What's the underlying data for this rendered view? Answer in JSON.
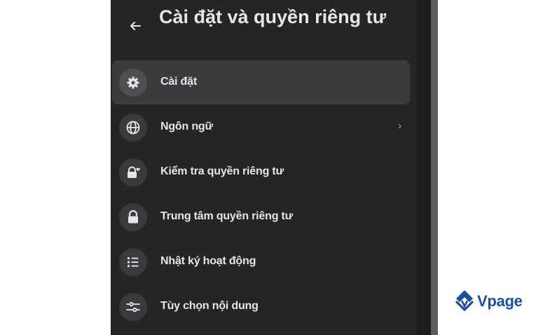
{
  "header": {
    "back_icon": "arrow-left-icon",
    "title": "Cài đặt và quyền riêng tư"
  },
  "menu": {
    "items": [
      {
        "label": "Cài đặt",
        "icon": "gear-icon",
        "active": true
      },
      {
        "label": "Ngôn ngữ",
        "icon": "globe-icon",
        "has_chevron": true,
        "chevron": "›"
      },
      {
        "label": "Kiểm tra quyền riêng tư",
        "icon": "lock-heart-icon"
      },
      {
        "label": "Trung tâm quyền riêng tư",
        "icon": "lock-icon"
      },
      {
        "label": "Nhật ký hoạt động",
        "icon": "list-icon"
      },
      {
        "label": "Tùy chọn nội dung",
        "icon": "sliders-icon"
      }
    ]
  },
  "watermark": {
    "brand": "Vpage",
    "brand_color": "#1a4f9e"
  },
  "colors": {
    "panel_bg": "#252526",
    "active_item_bg": "#3a3b3c",
    "text": "#e4e6eb",
    "icon_circle": "#3a3b3c"
  }
}
